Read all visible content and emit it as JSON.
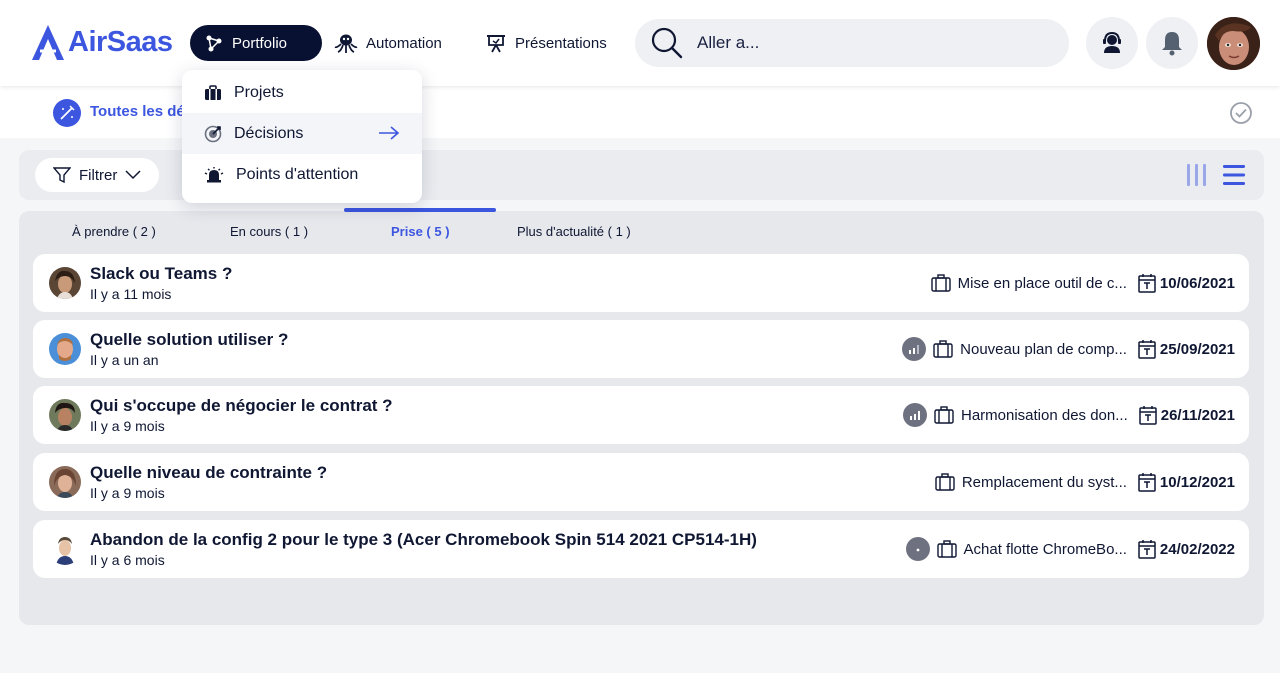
{
  "app": {
    "logo_text": "AirSaas",
    "brand_color": "#3c56e0",
    "nav_active_color": "#081132"
  },
  "nav": {
    "portfolio": "Portfolio",
    "automation": "Automation",
    "presentations": "Présentations"
  },
  "search": {
    "placeholder": "Aller a..."
  },
  "dropdown": {
    "items": [
      {
        "label": "Projets",
        "icon": "briefcase-icon"
      },
      {
        "label": "Décisions",
        "icon": "target-icon"
      },
      {
        "label": "Points d'attention",
        "icon": "alarm-icon"
      }
    ]
  },
  "subheader": {
    "title": "Toutes les déc"
  },
  "filter": {
    "label": "Filtrer"
  },
  "tabs": [
    {
      "label": "À prendre ( 2 )"
    },
    {
      "label": "En cours ( 1 )"
    },
    {
      "label": "Prise ( 5 )",
      "active": true
    },
    {
      "label": "Plus d'actualité ( 1 )"
    }
  ],
  "decisions": [
    {
      "title": "Slack ou Teams ?",
      "time": "Il y a 11 mois",
      "project": "Mise en place outil de c...",
      "date": "10/06/2021",
      "status_icon": null
    },
    {
      "title": "Quelle solution utiliser ?",
      "time": "Il y a un an",
      "project": "Nouveau plan de comp...",
      "date": "25/09/2021",
      "status_icon": "signal-icon"
    },
    {
      "title": "Qui s'occupe de négocier le contrat ?",
      "time": "Il y a 9 mois",
      "project": "Harmonisation des don...",
      "date": "26/11/2021",
      "status_icon": "signal-icon"
    },
    {
      "title": "Quelle niveau de contrainte ?",
      "time": "Il y a 9 mois",
      "project": "Remplacement du syst...",
      "date": "10/12/2021",
      "status_icon": null
    },
    {
      "title": "Abandon de la config 2 pour le type 3 (Acer Chromebook Spin 514 2021 CP514-1H)",
      "time": "Il y a 6 mois",
      "project": "Achat flotte ChromeBo...",
      "date": "24/02/2022",
      "status_icon": "dot-icon"
    }
  ]
}
